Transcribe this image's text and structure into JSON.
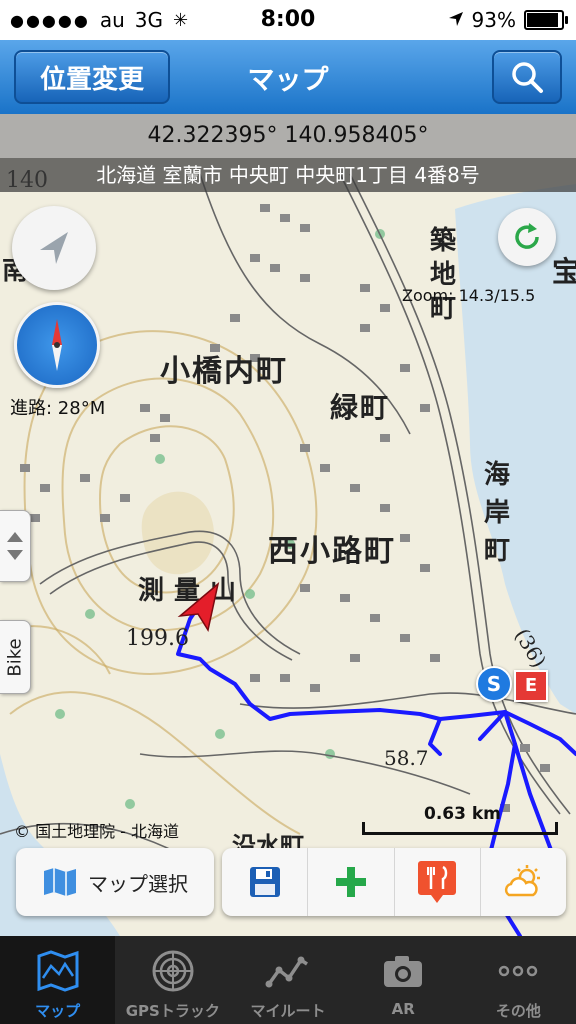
{
  "status_bar": {
    "carrier": "au",
    "network": "3G",
    "time": "8:00",
    "battery": "93%",
    "battery_level": 0.93
  },
  "nav": {
    "left_button": "位置変更",
    "title": "マップ",
    "right_icon": "search-icon"
  },
  "map": {
    "coordinates": "42.322395° 140.958405°",
    "address": "北海道 室蘭市 中央町 中央町1丁目 4番8号",
    "zoom": "Zoom: 14.3/15.5",
    "heading": "進路: 28°M",
    "scale": "0.63 km",
    "attribution": "© 国土地理院 - 北海道",
    "side_tab": "Bike",
    "labels": {
      "l1": "小橋内町",
      "l2": "緑町",
      "l3": "西小路町",
      "l4": "測量山",
      "l5": "海岸町",
      "l6": "築地町",
      "l7": "199.6",
      "l8": "58.7",
      "l9": "(36)",
      "l10": "沿水町",
      "l11": "宝",
      "l12": "南",
      "l13": "140"
    },
    "markers": {
      "start": "S",
      "end": "E"
    },
    "route_color": "#1a1aff"
  },
  "toolbar": {
    "map_select": "マップ選択",
    "icons": [
      "save-icon",
      "add-icon",
      "restaurant-icon",
      "weather-icon"
    ]
  },
  "tabs": [
    {
      "label": "マップ",
      "icon": "map-icon",
      "active": true
    },
    {
      "label": "GPSトラック",
      "icon": "radar-icon",
      "active": false
    },
    {
      "label": "マイルート",
      "icon": "route-icon",
      "active": false
    },
    {
      "label": "AR",
      "icon": "camera-icon",
      "active": false
    },
    {
      "label": "その他",
      "icon": "more-icon",
      "active": false
    }
  ]
}
